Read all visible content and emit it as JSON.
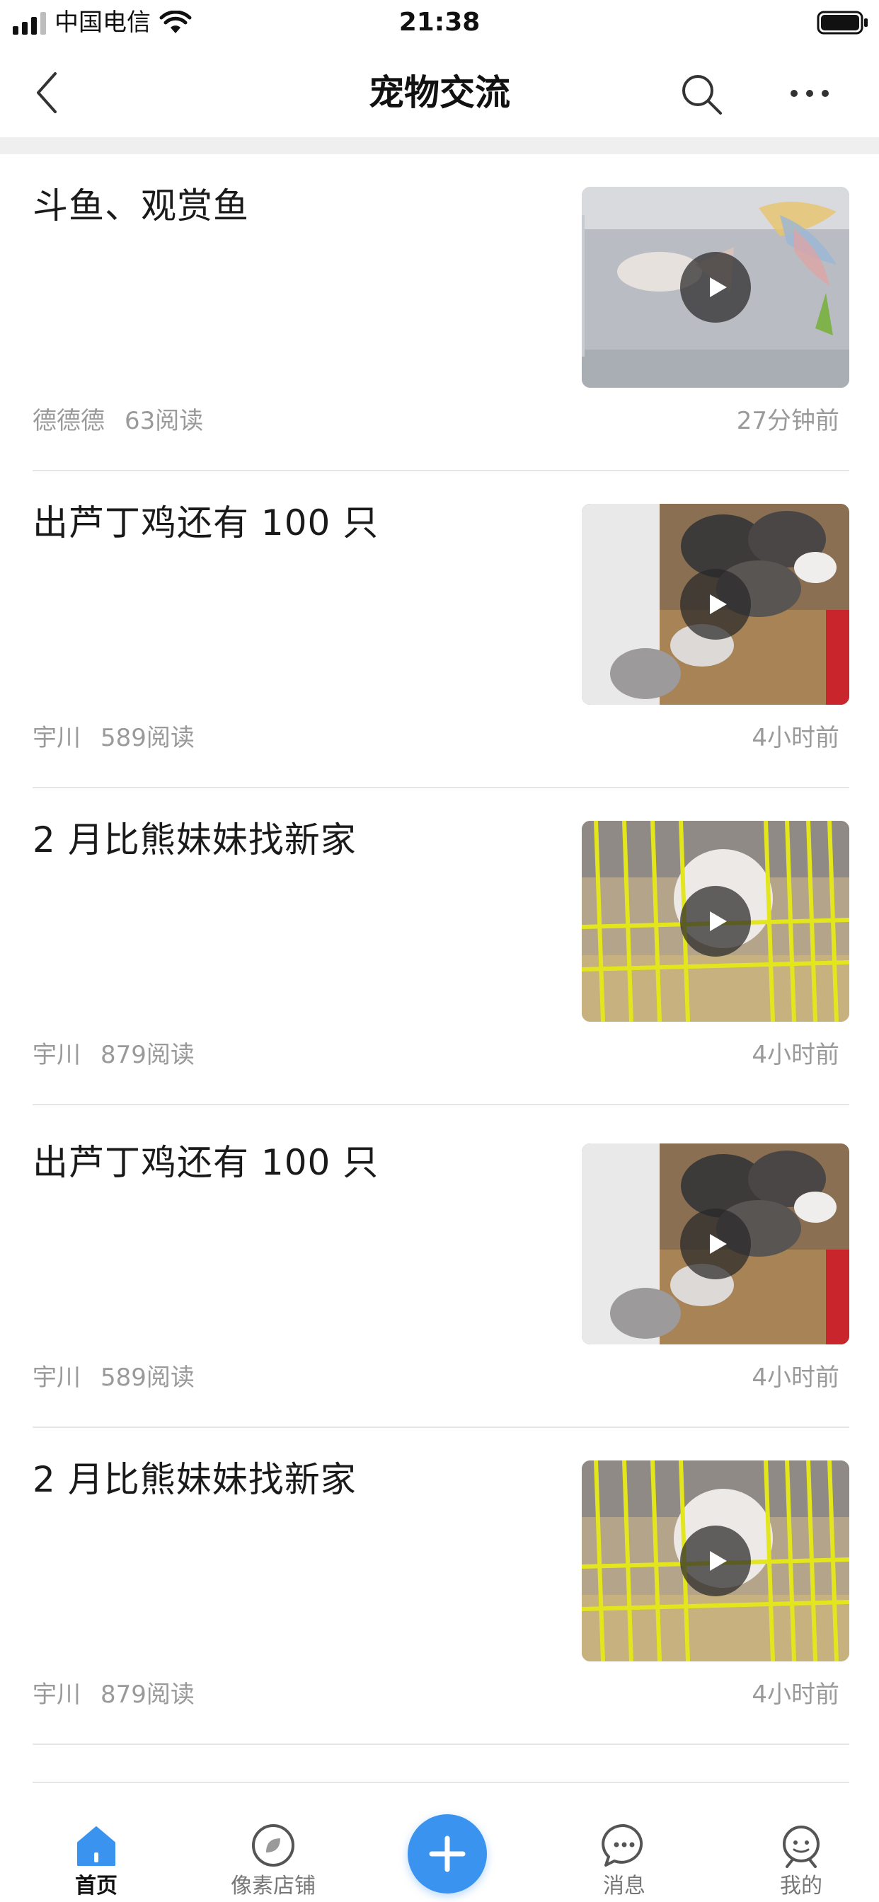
{
  "status_bar": {
    "carrier": "中国电信",
    "time": "21:38"
  },
  "nav": {
    "title": "宠物交流"
  },
  "posts": [
    {
      "title": "斗鱼、观赏鱼",
      "author": "德德德",
      "reads": "63阅读",
      "time": "27分钟前",
      "thumbnail": "betta-fish-tank"
    },
    {
      "title": "出芦丁鸡还有 100 只",
      "author": "宇川",
      "reads": "589阅读",
      "time": "4小时前",
      "thumbnail": "chicks-in-pen"
    },
    {
      "title": "2 月比熊妹妹找新家",
      "author": "宇川",
      "reads": "879阅读",
      "time": "4小时前",
      "thumbnail": "puppy-in-yellow-cage"
    },
    {
      "title": "出芦丁鸡还有 100 只",
      "author": "宇川",
      "reads": "589阅读",
      "time": "4小时前",
      "thumbnail": "chicks-in-pen"
    },
    {
      "title": "2 月比熊妹妹找新家",
      "author": "宇川",
      "reads": "879阅读",
      "time": "4小时前",
      "thumbnail": "puppy-in-yellow-cage"
    }
  ],
  "tab_bar": {
    "items": [
      {
        "label": "首页",
        "icon": "home-icon",
        "active": true
      },
      {
        "label": "像素店铺",
        "icon": "shop-icon",
        "active": false
      },
      {
        "label": "",
        "icon": "plus-icon",
        "active": false
      },
      {
        "label": "消息",
        "icon": "message-icon",
        "active": false
      },
      {
        "label": "我的",
        "icon": "profile-icon",
        "active": false
      }
    ]
  },
  "colors": {
    "accent": "#3a93ee",
    "meta_text": "#9a9a9a",
    "divider": "#e6e6e6"
  }
}
